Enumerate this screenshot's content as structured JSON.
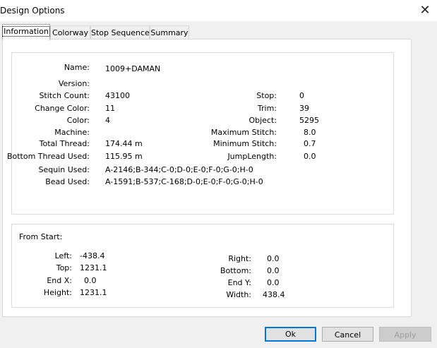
{
  "window": {
    "title": "Design Options",
    "close_glyph": "✕"
  },
  "tabs": [
    "Information",
    "Colorway",
    "Stop Sequence",
    "Summary"
  ],
  "info": {
    "name_label": "Name:",
    "name_value": "1009+DAMAN",
    "version_label": "Version:",
    "stitch_count_label": "Stitch Count:",
    "stitch_count_value": "43100",
    "change_color_label": "Change Color:",
    "change_color_value": "11",
    "color_label": "Color:",
    "color_value": "4",
    "machine_label": "Machine:",
    "total_thread_label": "Total Thread:",
    "total_thread_value": "174.44 m",
    "bottom_thread_label": "Bottom Thread Used:",
    "bottom_thread_value": "115.95 m",
    "sequin_label": "Sequin Used:",
    "sequin_value": "A-2146;B-344;C-0;D-0;E-0;F-0;G-0;H-0",
    "bead_label": "Bead Used:",
    "bead_value": "A-1591;B-537;C-168;D-0;E-0;F-0;G-0;H-0",
    "stop_label": "Stop:",
    "stop_value": "0",
    "trim_label": "Trim:",
    "trim_value": "39",
    "object_label": "Object:",
    "object_value": "5295",
    "max_stitch_label": "Maximum Stitch:",
    "max_stitch_value": "8.0",
    "min_stitch_label": "Minimum Stitch:",
    "min_stitch_value": "0.7",
    "jump_label": "JumpLength:",
    "jump_value": "0.0"
  },
  "from_start": {
    "heading": "From Start:",
    "left_label": "Left:",
    "left_value": "-438.4",
    "top_label": "Top:",
    "top_value": "1231.1",
    "endx_label": "End X:",
    "endx_value": "0.0",
    "height_label": "Height:",
    "height_value": "1231.1",
    "right_label": "Right:",
    "right_value": "0.0",
    "bottom_label": "Bottom:",
    "bottom_value": "0.0",
    "endy_label": "End Y:",
    "endy_value": "0.0",
    "width_label": "Width:",
    "width_value": "438.4"
  },
  "buttons": {
    "ok": "Ok",
    "cancel": "Cancel",
    "apply": "Apply"
  },
  "colors": {
    "accent": "#0078d7",
    "dialog_bg": "#f0f0f0"
  }
}
